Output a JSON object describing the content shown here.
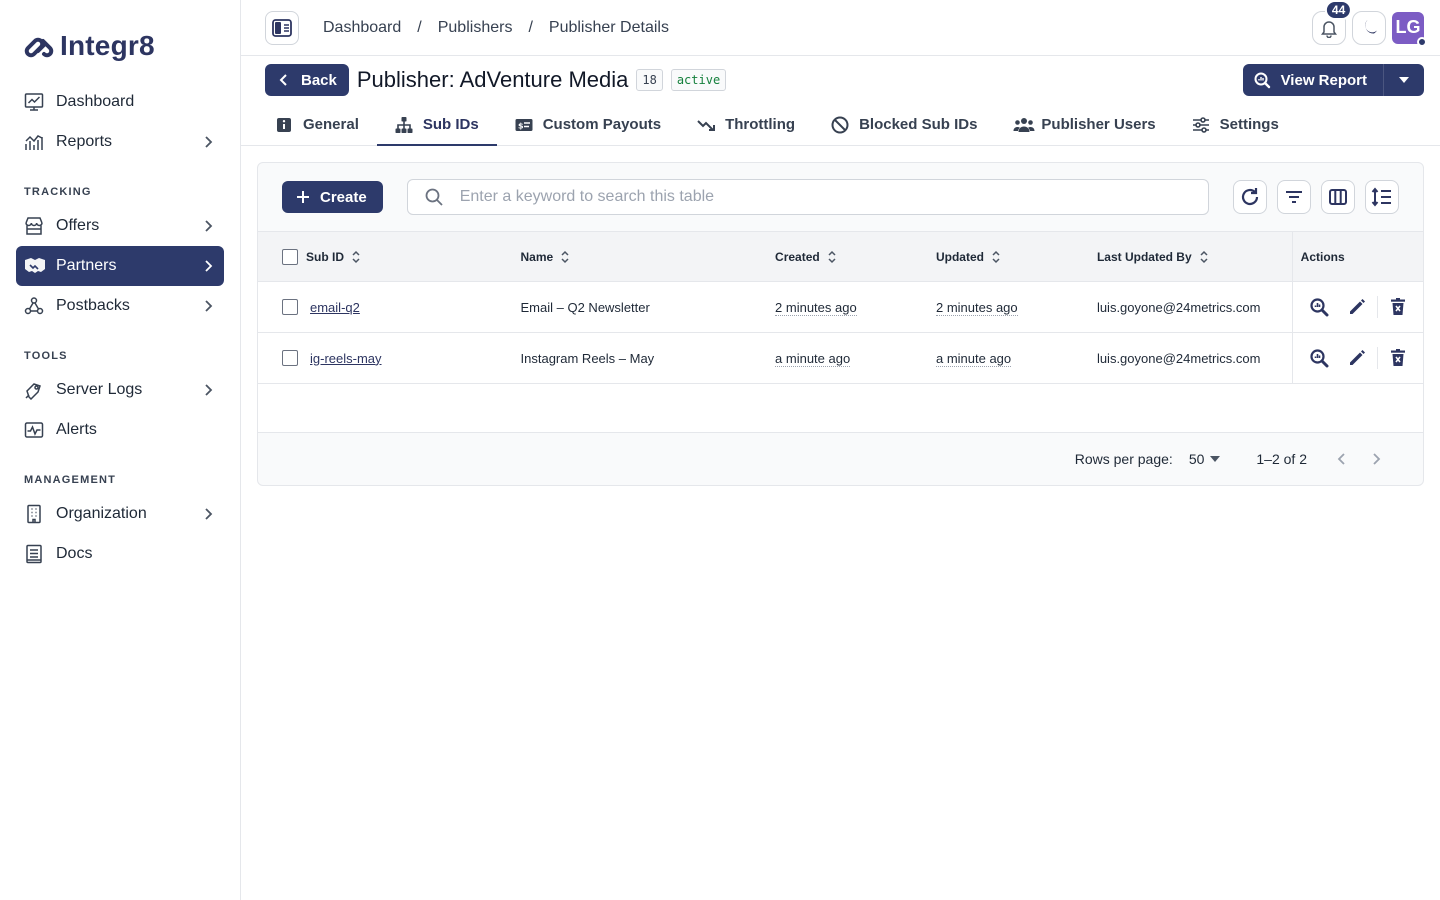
{
  "app": {
    "name": "Integr8"
  },
  "sidebar": {
    "items_top": [
      {
        "label": "Dashboard",
        "icon": "dashboard-icon",
        "chevron": false
      },
      {
        "label": "Reports",
        "icon": "reports-icon",
        "chevron": true
      }
    ],
    "section_tracking": "TRACKING",
    "items_tracking": [
      {
        "label": "Offers",
        "icon": "offers-icon",
        "chevron": true
      },
      {
        "label": "Partners",
        "icon": "partners-icon",
        "chevron": true,
        "active": true
      },
      {
        "label": "Postbacks",
        "icon": "postbacks-icon",
        "chevron": true
      }
    ],
    "section_tools": "TOOLS",
    "items_tools": [
      {
        "label": "Server Logs",
        "icon": "server-logs-icon",
        "chevron": true
      },
      {
        "label": "Alerts",
        "icon": "alerts-icon",
        "chevron": false
      }
    ],
    "section_management": "MANAGEMENT",
    "items_management": [
      {
        "label": "Organization",
        "icon": "organization-icon",
        "chevron": true
      },
      {
        "label": "Docs",
        "icon": "docs-icon",
        "chevron": false
      }
    ]
  },
  "topbar": {
    "breadcrumb": [
      "Dashboard",
      "Publishers",
      "Publisher Details"
    ],
    "breadcrumb_sep": "/",
    "notifications_count": "44",
    "avatar_initials": "LG"
  },
  "header": {
    "back_label": "Back",
    "title": "Publisher: AdVenture Media",
    "id_chip": "18",
    "status_chip": "active",
    "view_report_label": "View Report"
  },
  "tabs": [
    {
      "label": "General",
      "icon": "info-icon"
    },
    {
      "label": "Sub IDs",
      "icon": "hierarchy-icon",
      "active": true
    },
    {
      "label": "Custom Payouts",
      "icon": "money-card-icon"
    },
    {
      "label": "Throttling",
      "icon": "trend-down-icon"
    },
    {
      "label": "Blocked Sub IDs",
      "icon": "block-icon"
    },
    {
      "label": "Publisher Users",
      "icon": "users-icon"
    },
    {
      "label": "Settings",
      "icon": "sliders-icon"
    }
  ],
  "table": {
    "create_label": "Create",
    "search_placeholder": "Enter a keyword to search this table",
    "columns": [
      "Sub ID",
      "Name",
      "Created",
      "Updated",
      "Last Updated By",
      "Actions"
    ],
    "rows": [
      {
        "sub_id": "email-q2",
        "name": "Email – Q2 Newsletter",
        "created": "2 minutes ago",
        "updated": "2 minutes ago",
        "updated_by": "luis.goyone@24metrics.com"
      },
      {
        "sub_id": "ig-reels-may",
        "name": "Instagram Reels – May",
        "created": "a minute ago",
        "updated": "a minute ago",
        "updated_by": "luis.goyone@24metrics.com"
      }
    ],
    "footer": {
      "rows_per_page_label": "Rows per page:",
      "rows_per_page_value": "50",
      "range": "1–2 of 2"
    }
  },
  "colors": {
    "primary": "#2d3a6b",
    "status_active": "#15803d",
    "avatar": "#7c5cc4"
  }
}
